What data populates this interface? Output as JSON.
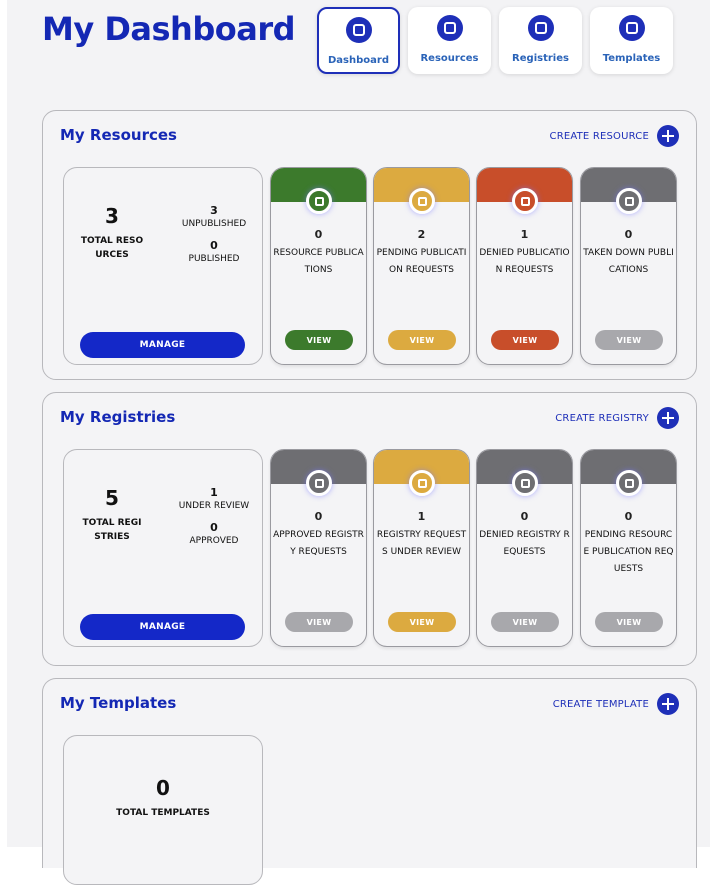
{
  "page_title": "My Dashboard",
  "nav_tabs": [
    {
      "label": "Dashboard",
      "icon": "dashboard-icon"
    },
    {
      "label": "Resources",
      "icon": "resource-icon"
    },
    {
      "label": "Registries",
      "icon": "registry-icon"
    },
    {
      "label": "Templates",
      "icon": "template-icon"
    }
  ],
  "colors": {
    "brand_blue": "#1428c8",
    "green": "#3c7a2c",
    "yellow": "#dcaa40",
    "red": "#c84e2a",
    "gray": "#6e6e72",
    "gray_button": "#a8a8ac"
  },
  "resources": {
    "title": "My Resources",
    "create_label": "CREATE RESOURCE",
    "total_num": "3",
    "total_label": "TOTAL RESOURCES",
    "stat1_num": "3",
    "stat1_label": "UNPUBLISHED",
    "stat2_num": "0",
    "stat2_label": "PUBLISHED",
    "manage_label": "MANAGE",
    "cards": [
      {
        "num": "0",
        "label": "RESOURCE PUBLICATIONS",
        "view": "VIEW",
        "color": "#3c7a2c",
        "btn": "#3c7a2c"
      },
      {
        "num": "2",
        "label": "PENDING PUBLICATION REQUESTS",
        "view": "VIEW",
        "color": "#dcaa40",
        "btn": "#dcaa40"
      },
      {
        "num": "1",
        "label": "DENIED PUBLICATION REQUESTS",
        "view": "VIEW",
        "color": "#c84e2a",
        "btn": "#c84e2a"
      },
      {
        "num": "0",
        "label": "TAKEN DOWN PUBLICATIONS",
        "view": "VIEW",
        "color": "#6e6e72",
        "btn": "#a8a8ac"
      }
    ]
  },
  "registries": {
    "title": "My Registries",
    "create_label": "CREATE REGISTRY",
    "total_num": "5",
    "total_label": "TOTAL REGISTRIES",
    "stat1_num": "1",
    "stat1_label": "UNDER REVIEW",
    "stat2_num": "0",
    "stat2_label": "APPROVED",
    "manage_label": "MANAGE",
    "cards": [
      {
        "num": "0",
        "label": "APPROVED REGISTRY REQUESTS",
        "view": "VIEW",
        "color": "#6e6e72",
        "btn": "#a8a8ac"
      },
      {
        "num": "1",
        "label": "REGISTRY REQUESTS UNDER REVIEW",
        "view": "VIEW",
        "color": "#dcaa40",
        "btn": "#dcaa40"
      },
      {
        "num": "0",
        "label": "DENIED REGISTRY REQUESTS",
        "view": "VIEW",
        "color": "#6e6e72",
        "btn": "#a8a8ac"
      },
      {
        "num": "0",
        "label": "PENDING RESOURCE PUBLICATION REQUESTS",
        "view": "VIEW",
        "color": "#6e6e72",
        "btn": "#a8a8ac"
      }
    ]
  },
  "templates": {
    "title": "My Templates",
    "create_label": "CREATE TEMPLATE",
    "total_num": "0",
    "total_label": "TOTAL TEMPLATES"
  }
}
